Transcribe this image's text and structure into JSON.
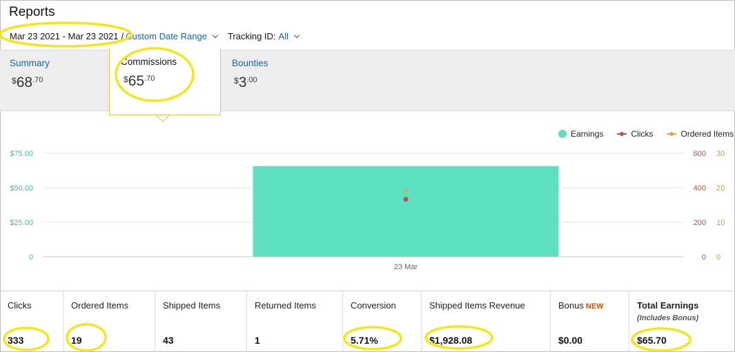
{
  "page": {
    "title": "Reports"
  },
  "date_filter": {
    "range": "Mar 23 2021 - Mar 23 2021",
    "separator": "/",
    "range_type": "Custom Date Range",
    "tracking_label": "Tracking ID:",
    "tracking_value": "All"
  },
  "tabs": [
    {
      "label": "Summary",
      "currency": "$",
      "whole": "68",
      "cents": ".70",
      "active": false
    },
    {
      "label": "Commissions",
      "currency": "$",
      "whole": "65",
      "cents": ".70",
      "active": true
    },
    {
      "label": "Bounties",
      "currency": "$",
      "whole": "3",
      "cents": ".00",
      "active": false
    }
  ],
  "legend": [
    {
      "label": "Earnings",
      "color": "#5ee0c2",
      "icon": "filled-circle"
    },
    {
      "label": "Clicks",
      "color": "#c94a4a",
      "icon": "line-dot"
    },
    {
      "label": "Ordered Items",
      "color": "#e8a830",
      "icon": "line-dot"
    }
  ],
  "chart_data": {
    "type": "bar",
    "categories": [
      "23 Mar"
    ],
    "series": [
      {
        "name": "Earnings",
        "axis": "left",
        "values": [
          65.7
        ],
        "color": "#5ee0c2"
      },
      {
        "name": "Clicks",
        "axis": "right1",
        "values": [
          333
        ],
        "color": "#c94a4a",
        "style": "point"
      },
      {
        "name": "Ordered Items",
        "axis": "right2",
        "values": [
          19
        ],
        "color": "#e8a830",
        "style": "point"
      }
    ],
    "axes": {
      "left": {
        "ticks": [
          "0",
          "$25.00",
          "$50.00",
          "$75.00"
        ],
        "ylim": [
          0,
          75
        ],
        "color": "#3dbfa0"
      },
      "right1": {
        "ticks": [
          "0",
          "200",
          "400",
          "600"
        ],
        "ylim": [
          0,
          600
        ],
        "color": "#c94a4a"
      },
      "right2": {
        "ticks": [
          "0",
          "10",
          "20",
          "30"
        ],
        "ylim": [
          0,
          30
        ],
        "color": "#c9a227"
      }
    },
    "grid": true,
    "legend_position": "top-right"
  },
  "metrics": [
    {
      "label": "Clicks",
      "value": "333"
    },
    {
      "label": "Ordered Items",
      "value": "19"
    },
    {
      "label": "Shipped Items",
      "value": "43"
    },
    {
      "label": "Returned Items",
      "value": "1"
    },
    {
      "label": "Conversion",
      "value": "5.71%"
    },
    {
      "label": "Shipped Items Revenue",
      "value": "$1,928.08"
    },
    {
      "label": "Bonus",
      "badge": "NEW",
      "value": "$0.00"
    },
    {
      "label": "Total Earnings",
      "sublabel": "(Includes Bonus)",
      "value": "$65.70"
    }
  ],
  "annotations": {
    "highlight_color": "#f5e61a"
  }
}
